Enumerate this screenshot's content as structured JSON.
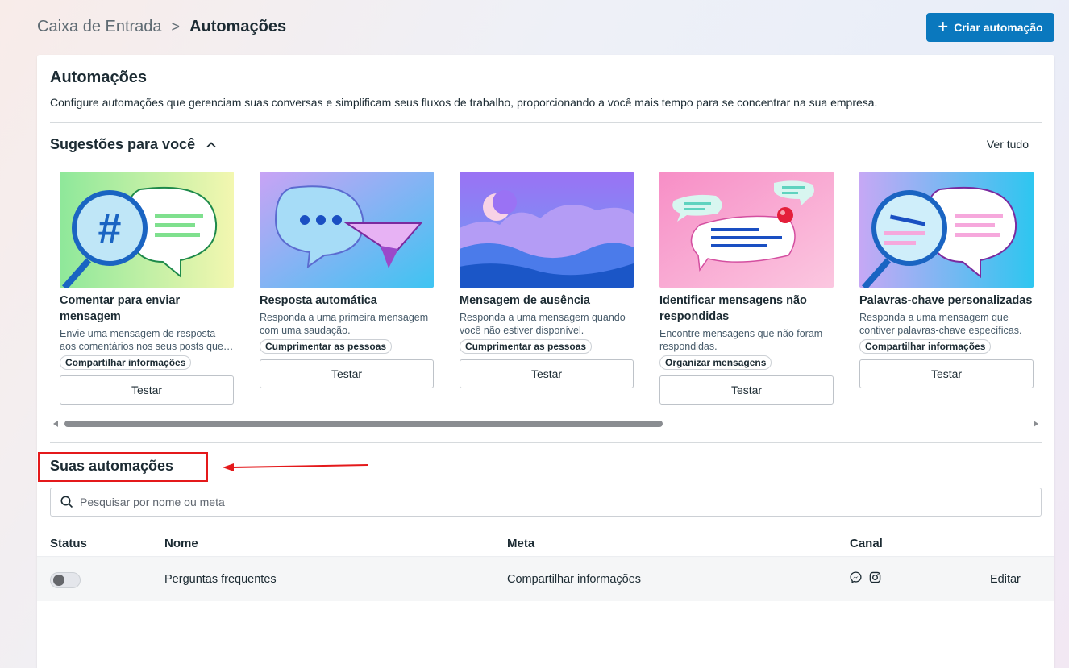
{
  "header": {
    "breadcrumb_parent": "Caixa de Entrada",
    "breadcrumb_current": "Automações",
    "create_button": "Criar automação"
  },
  "page": {
    "title": "Automações",
    "description": "Configure automações que gerenciam suas conversas e simplificam seus fluxos de trabalho, proporcionando a você mais tempo para se concentrar na sua empresa."
  },
  "suggestions": {
    "title": "Sugestões para você",
    "see_all": "Ver tudo",
    "cards": [
      {
        "title": "Comentar para enviar mensagem",
        "description": "Envie uma mensagem de resposta aos comentários nos seus posts que…",
        "tag": "Compartilhar informações",
        "button": "Testar"
      },
      {
        "title": "Resposta automática",
        "description": "Responda a uma primeira mensagem com uma saudação.",
        "tag": "Cumprimentar as pessoas",
        "button": "Testar"
      },
      {
        "title": "Mensagem de ausência",
        "description": "Responda a uma mensagem quando você não estiver disponível.",
        "tag": "Cumprimentar as pessoas",
        "button": "Testar"
      },
      {
        "title": "Identificar mensagens não respondidas",
        "description": "Encontre mensagens que não foram respondidas.",
        "tag": "Organizar mensagens",
        "button": "Testar"
      },
      {
        "title": "Palavras-chave personalizadas",
        "description": "Responda a uma mensagem que contiver palavras-chave específicas.",
        "tag": "Compartilhar informações",
        "button": "Testar"
      }
    ]
  },
  "your_automations": {
    "title": "Suas automações",
    "search_placeholder": "Pesquisar por nome ou meta",
    "columns": {
      "status": "Status",
      "name": "Nome",
      "goal": "Meta",
      "channel": "Canal"
    },
    "rows": [
      {
        "status": "off",
        "name": "Perguntas frequentes",
        "goal": "Compartilhar informações",
        "channels": [
          "messenger-icon",
          "instagram-icon"
        ],
        "action": "Editar"
      }
    ]
  },
  "colors": {
    "primary": "#0a78be",
    "annotation": "#e4191b"
  }
}
